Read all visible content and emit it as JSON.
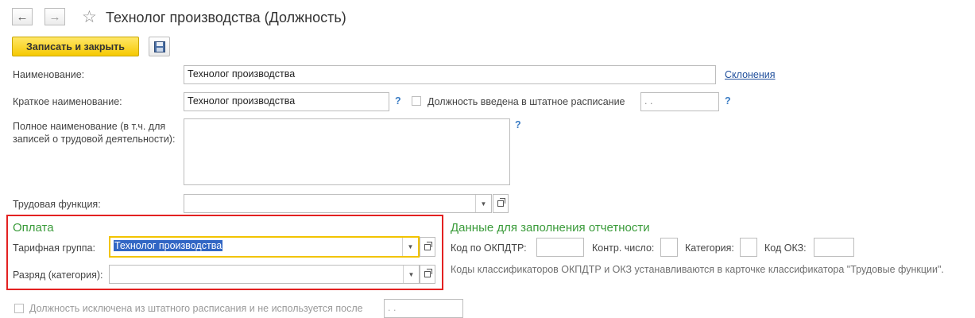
{
  "header": {
    "back_icon": "arrow-left-icon",
    "forward_icon": "arrow-right-icon",
    "favorite_icon": "star-icon",
    "title": "Технолог производства (Должность)"
  },
  "toolbar": {
    "save_close_label": "Записать и закрыть",
    "save_icon": "floppy-disk-icon"
  },
  "form": {
    "name_label": "Наименование:",
    "name_value": "Технолог производства",
    "declensions_link": "Склонения",
    "short_name_label": "Краткое наименование:",
    "short_name_value": "Технолог производства",
    "help_mark": "?",
    "staffing_checkbox_label": "Должность введена в штатное расписание",
    "staffing_date_placeholder": ". .",
    "full_name_label_line1": "Полное наименование (в т.ч. для",
    "full_name_label_line2": "записей о трудовой деятельности):",
    "full_name_value": "",
    "labor_function_label": "Трудовая функция:",
    "labor_function_value": ""
  },
  "payment": {
    "title": "Оплата",
    "tariff_group_label": "Тарифная группа:",
    "tariff_group_value": "Технолог производства",
    "grade_label": "Разряд (категория):",
    "grade_value": ""
  },
  "reporting": {
    "title": "Данные для заполнения отчетности",
    "okpdtr_label": "Код по ОКПДТР:",
    "control_number_label": "Контр. число:",
    "category_label": "Категория:",
    "okz_label": "Код ОКЗ:",
    "note": "Коды классификаторов ОКПДТР и ОКЗ устанавливаются в карточке классификатора \"Трудовые функции\"."
  },
  "footer": {
    "excluded_checkbox_label": "Должность исключена из штатного расписания и не используется после",
    "excluded_date_placeholder": ". ."
  }
}
